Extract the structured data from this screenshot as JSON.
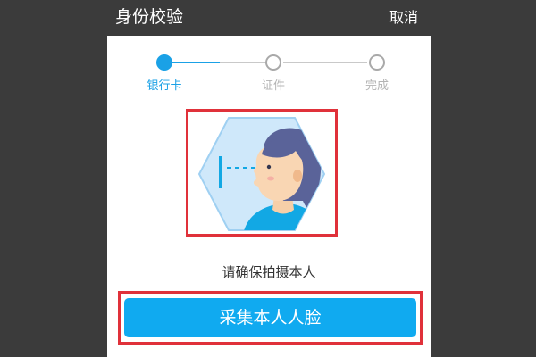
{
  "header": {
    "title": "身份校验",
    "cancel_label": "取消"
  },
  "steps": [
    {
      "label": "银行卡",
      "state": "active"
    },
    {
      "label": "证件",
      "state": "pending"
    },
    {
      "label": "完成",
      "state": "pending"
    }
  ],
  "illustration": {
    "icon": "face-capture-illustration"
  },
  "hint": "请确保拍摄本人",
  "capture_button_label": "采集本人人脸",
  "colors": {
    "accent": "#1aa1e6",
    "button": "#10aaf0",
    "highlight": "#e0313a",
    "backdrop": "#3b3b3b"
  }
}
